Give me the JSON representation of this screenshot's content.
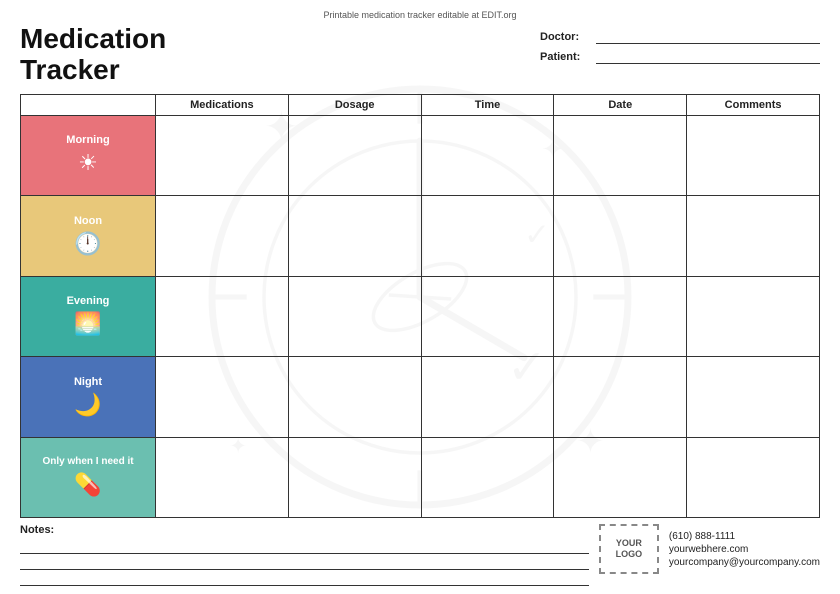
{
  "top_bar": {
    "text": "Printable medication tracker editable at EDIT.org"
  },
  "title": "Medication\nTracker",
  "header": {
    "doctor_label": "Doctor:",
    "patient_label": "Patient:"
  },
  "columns": {
    "empty": "",
    "medications": "Medications",
    "dosage": "Dosage",
    "time": "Time",
    "date": "Date",
    "comments": "Comments"
  },
  "rows": [
    {
      "id": "morning",
      "label": "Morning",
      "class": "morning",
      "icon": "☀"
    },
    {
      "id": "noon",
      "label": "Noon",
      "class": "noon",
      "icon": "🕛"
    },
    {
      "id": "evening",
      "label": "Evening",
      "class": "evening",
      "icon": "🌅"
    },
    {
      "id": "night",
      "label": "Night",
      "class": "night",
      "icon": "🌙"
    },
    {
      "id": "only-when",
      "label": "Only when I need it",
      "class": "only-when",
      "icon": "💊"
    }
  ],
  "footer": {
    "notes_label": "Notes:",
    "logo_line1": "YOUR",
    "logo_line2": "LOGO",
    "phone": "(610) 888-1111",
    "website": "yourwebhere.com",
    "email": "yourcompany@yourcompany.com"
  }
}
